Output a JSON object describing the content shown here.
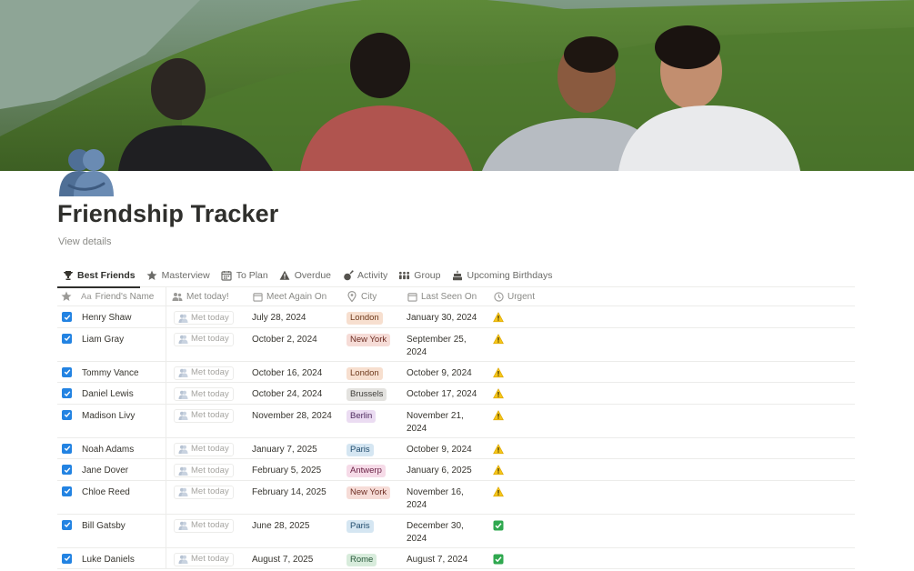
{
  "page": {
    "title": "Friendship Tracker",
    "view_details": "View details",
    "cover_icon": "cover-photo-friends",
    "page_icon": "people-hugging-icon"
  },
  "tabs": [
    {
      "label": "Best Friends",
      "icon": "trophy-icon",
      "active": true
    },
    {
      "label": "Masterview",
      "icon": "star-icon",
      "active": false
    },
    {
      "label": "To Plan",
      "icon": "calendar-icon",
      "active": false
    },
    {
      "label": "Overdue",
      "icon": "warning-icon",
      "active": false
    },
    {
      "label": "Activity",
      "icon": "activity-icon",
      "active": false
    },
    {
      "label": "Group",
      "icon": "group-icon",
      "active": false
    },
    {
      "label": "Upcoming Birthdays",
      "icon": "cake-icon",
      "active": false
    }
  ],
  "columns": {
    "name": "Friend's Name",
    "name_prefix": "Aa",
    "met": "Met today!",
    "meet_again": "Meet Again On",
    "city": "City",
    "last_seen": "Last Seen On",
    "urgent": "Urgent"
  },
  "met_label": "Met today",
  "city_colors": {
    "London": {
      "bg": "#f7dfcf",
      "fg": "#6e3a1c"
    },
    "New York": {
      "bg": "#f6dcd7",
      "fg": "#6d2e24"
    },
    "Brussels": {
      "bg": "#e3e2df",
      "fg": "#3f3e3a"
    },
    "Berlin": {
      "bg": "#ebdcf2",
      "fg": "#4d2a5e"
    },
    "Paris": {
      "bg": "#d5e6f2",
      "fg": "#1f4a6b"
    },
    "Antwerp": {
      "bg": "#f6dbe8",
      "fg": "#6b2447"
    },
    "Rome": {
      "bg": "#d8ecdc",
      "fg": "#27583a"
    }
  },
  "rows": [
    {
      "name": "Henry Shaw",
      "meet_again": "July 28, 2024",
      "city": "London",
      "last_seen": [
        "January 30, 2024"
      ],
      "urgent": "warning"
    },
    {
      "name": "Liam Gray",
      "meet_again": "October 2, 2024",
      "city": "New York",
      "last_seen": [
        "September 25,",
        "2024"
      ],
      "urgent": "warning"
    },
    {
      "name": "Tommy Vance",
      "meet_again": "October 16, 2024",
      "city": "London",
      "last_seen": [
        "October 9, 2024"
      ],
      "urgent": "warning"
    },
    {
      "name": "Daniel Lewis",
      "meet_again": "October 24, 2024",
      "city": "Brussels",
      "last_seen": [
        "October 17, 2024"
      ],
      "urgent": "warning"
    },
    {
      "name": "Madison Livy",
      "meet_again": "November 28, 2024",
      "city": "Berlin",
      "last_seen": [
        "November 21,",
        "2024"
      ],
      "urgent": "warning"
    },
    {
      "name": "Noah Adams",
      "meet_again": "January 7, 2025",
      "city": "Paris",
      "last_seen": [
        "October 9, 2024"
      ],
      "urgent": "warning"
    },
    {
      "name": "Jane Dover",
      "meet_again": "February 5, 2025",
      "city": "Antwerp",
      "last_seen": [
        "January 6, 2025"
      ],
      "urgent": "warning"
    },
    {
      "name": "Chloe Reed",
      "meet_again": "February 14, 2025",
      "city": "New York",
      "last_seen": [
        "November 16,",
        "2024"
      ],
      "urgent": "warning"
    },
    {
      "name": "Bill Gatsby",
      "meet_again": "June 28, 2025",
      "city": "Paris",
      "last_seen": [
        "December 30,",
        "2024"
      ],
      "urgent": "check"
    },
    {
      "name": "Luke Daniels",
      "meet_again": "August 7, 2025",
      "city": "Rome",
      "last_seen": [
        "August 7, 2024"
      ],
      "urgent": "check"
    }
  ]
}
